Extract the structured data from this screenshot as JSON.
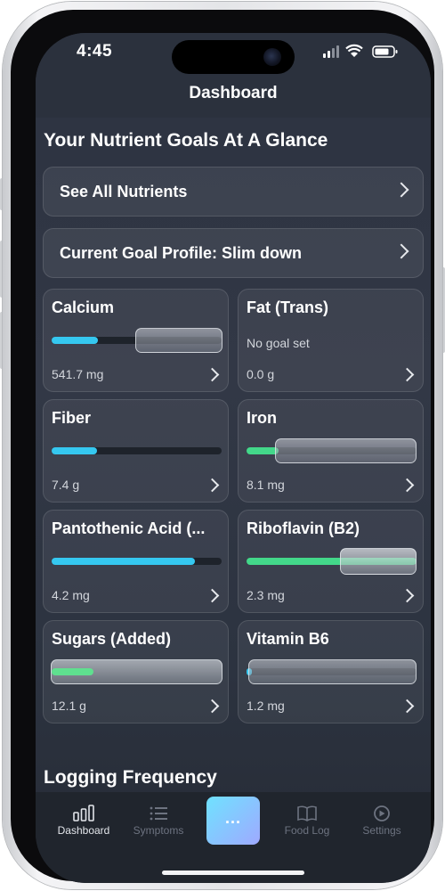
{
  "status_bar": {
    "time": "4:45"
  },
  "nav": {
    "title": "Dashboard"
  },
  "goals_section": {
    "title": "Your Nutrient Goals At A Glance"
  },
  "rows": [
    {
      "label": "See All Nutrients"
    },
    {
      "label": "Current Goal Profile: Slim down"
    }
  ],
  "nutrients": [
    {
      "name": "Calcium",
      "amount": "541.7 mg",
      "progress": 0.28,
      "color": "#35c8f0",
      "goal_set": true
    },
    {
      "name": "Fat (Trans)",
      "amount": "0.0 g",
      "note": "No goal set",
      "goal_set": false
    },
    {
      "name": "Fiber",
      "amount": "7.4 g",
      "progress": 0.27,
      "color": "#35c8f0",
      "goal_set": true
    },
    {
      "name": "Iron",
      "amount": "8.1 mg",
      "progress": 0.18,
      "color": "#43d88a",
      "goal_set": true
    },
    {
      "name": "Pantothenic Acid (...",
      "amount": "4.2 mg",
      "progress": 0.84,
      "color": "#35c8f0",
      "goal_set": true
    },
    {
      "name": "Riboflavin (B2)",
      "amount": "2.3 mg",
      "progress": 1.0,
      "color": "#43d88a",
      "goal_set": true
    },
    {
      "name": "Sugars (Added)",
      "amount": "12.1 g",
      "progress": 0.25,
      "color": "#5fe08f",
      "goal_set": true
    },
    {
      "name": "Vitamin B6",
      "amount": "1.2 mg",
      "progress": 0.03,
      "color": "#35c8f0",
      "goal_set": true
    }
  ],
  "logging_section": {
    "title": "Logging Frequency"
  },
  "tabs": [
    {
      "label": "Dashboard",
      "icon": "bar-chart-icon",
      "active": true
    },
    {
      "label": "Symptoms",
      "icon": "list-icon",
      "active": false
    },
    {
      "label": "Food Log",
      "icon": "book-icon",
      "active": false
    },
    {
      "label": "Settings",
      "icon": "gear-icon",
      "active": false
    }
  ],
  "center_button": {
    "label": "...",
    "icon": "more-icon"
  }
}
